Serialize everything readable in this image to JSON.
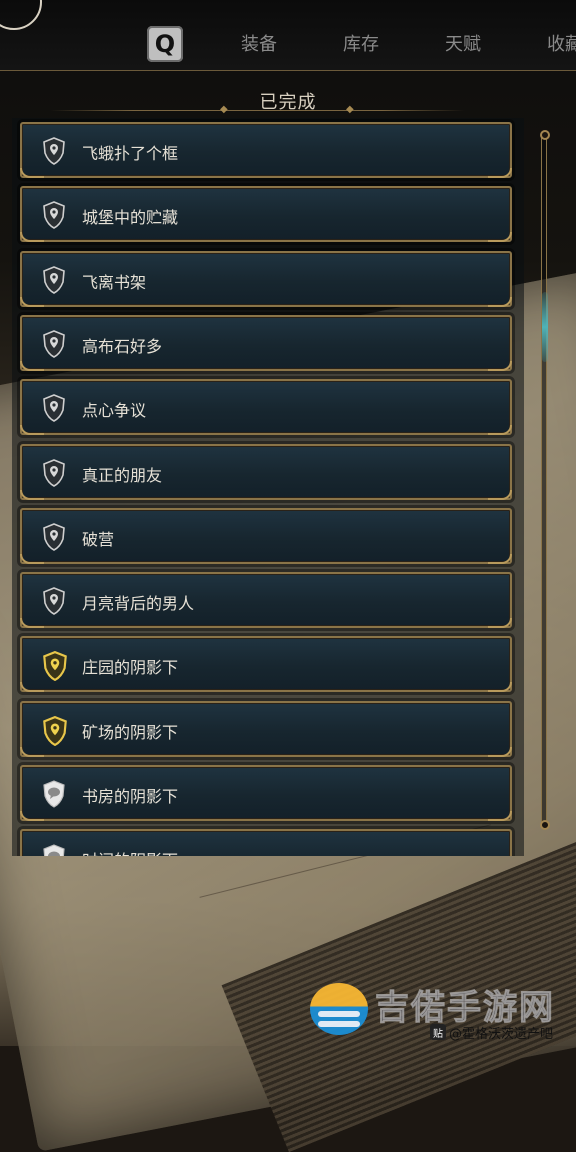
{
  "topbar": {
    "search_key": "Q",
    "tabs": [
      {
        "label": "装备"
      },
      {
        "label": "库存"
      },
      {
        "label": "天赋"
      },
      {
        "label": "收藏"
      }
    ]
  },
  "section": {
    "title": "已完成"
  },
  "quests": [
    {
      "label": "飞蛾扑了个框",
      "icon": "shield-pin-icon"
    },
    {
      "label": "城堡中的贮藏",
      "icon": "shield-pin-icon"
    },
    {
      "label": "飞离书架",
      "icon": "shield-pin-icon"
    },
    {
      "label": "高布石好多",
      "icon": "shield-pin-icon"
    },
    {
      "label": "点心争议",
      "icon": "shield-pin-icon"
    },
    {
      "label": "真正的朋友",
      "icon": "shield-pin-icon"
    },
    {
      "label": "破营",
      "icon": "shield-pin-icon"
    },
    {
      "label": "月亮背后的男人",
      "icon": "shield-pin-icon"
    },
    {
      "label": "庄园的阴影下",
      "icon": "gold-shield-icon"
    },
    {
      "label": "矿场的阴影下",
      "icon": "gold-shield-icon"
    },
    {
      "label": "书房的阴影下",
      "icon": "speech-shield-icon"
    },
    {
      "label": "时间的阴影下",
      "icon": "speech-shield-icon"
    }
  ],
  "watermark": {
    "site_text": "吉偌手游网",
    "credit_text": "@霍格沃茨遗产吧"
  }
}
